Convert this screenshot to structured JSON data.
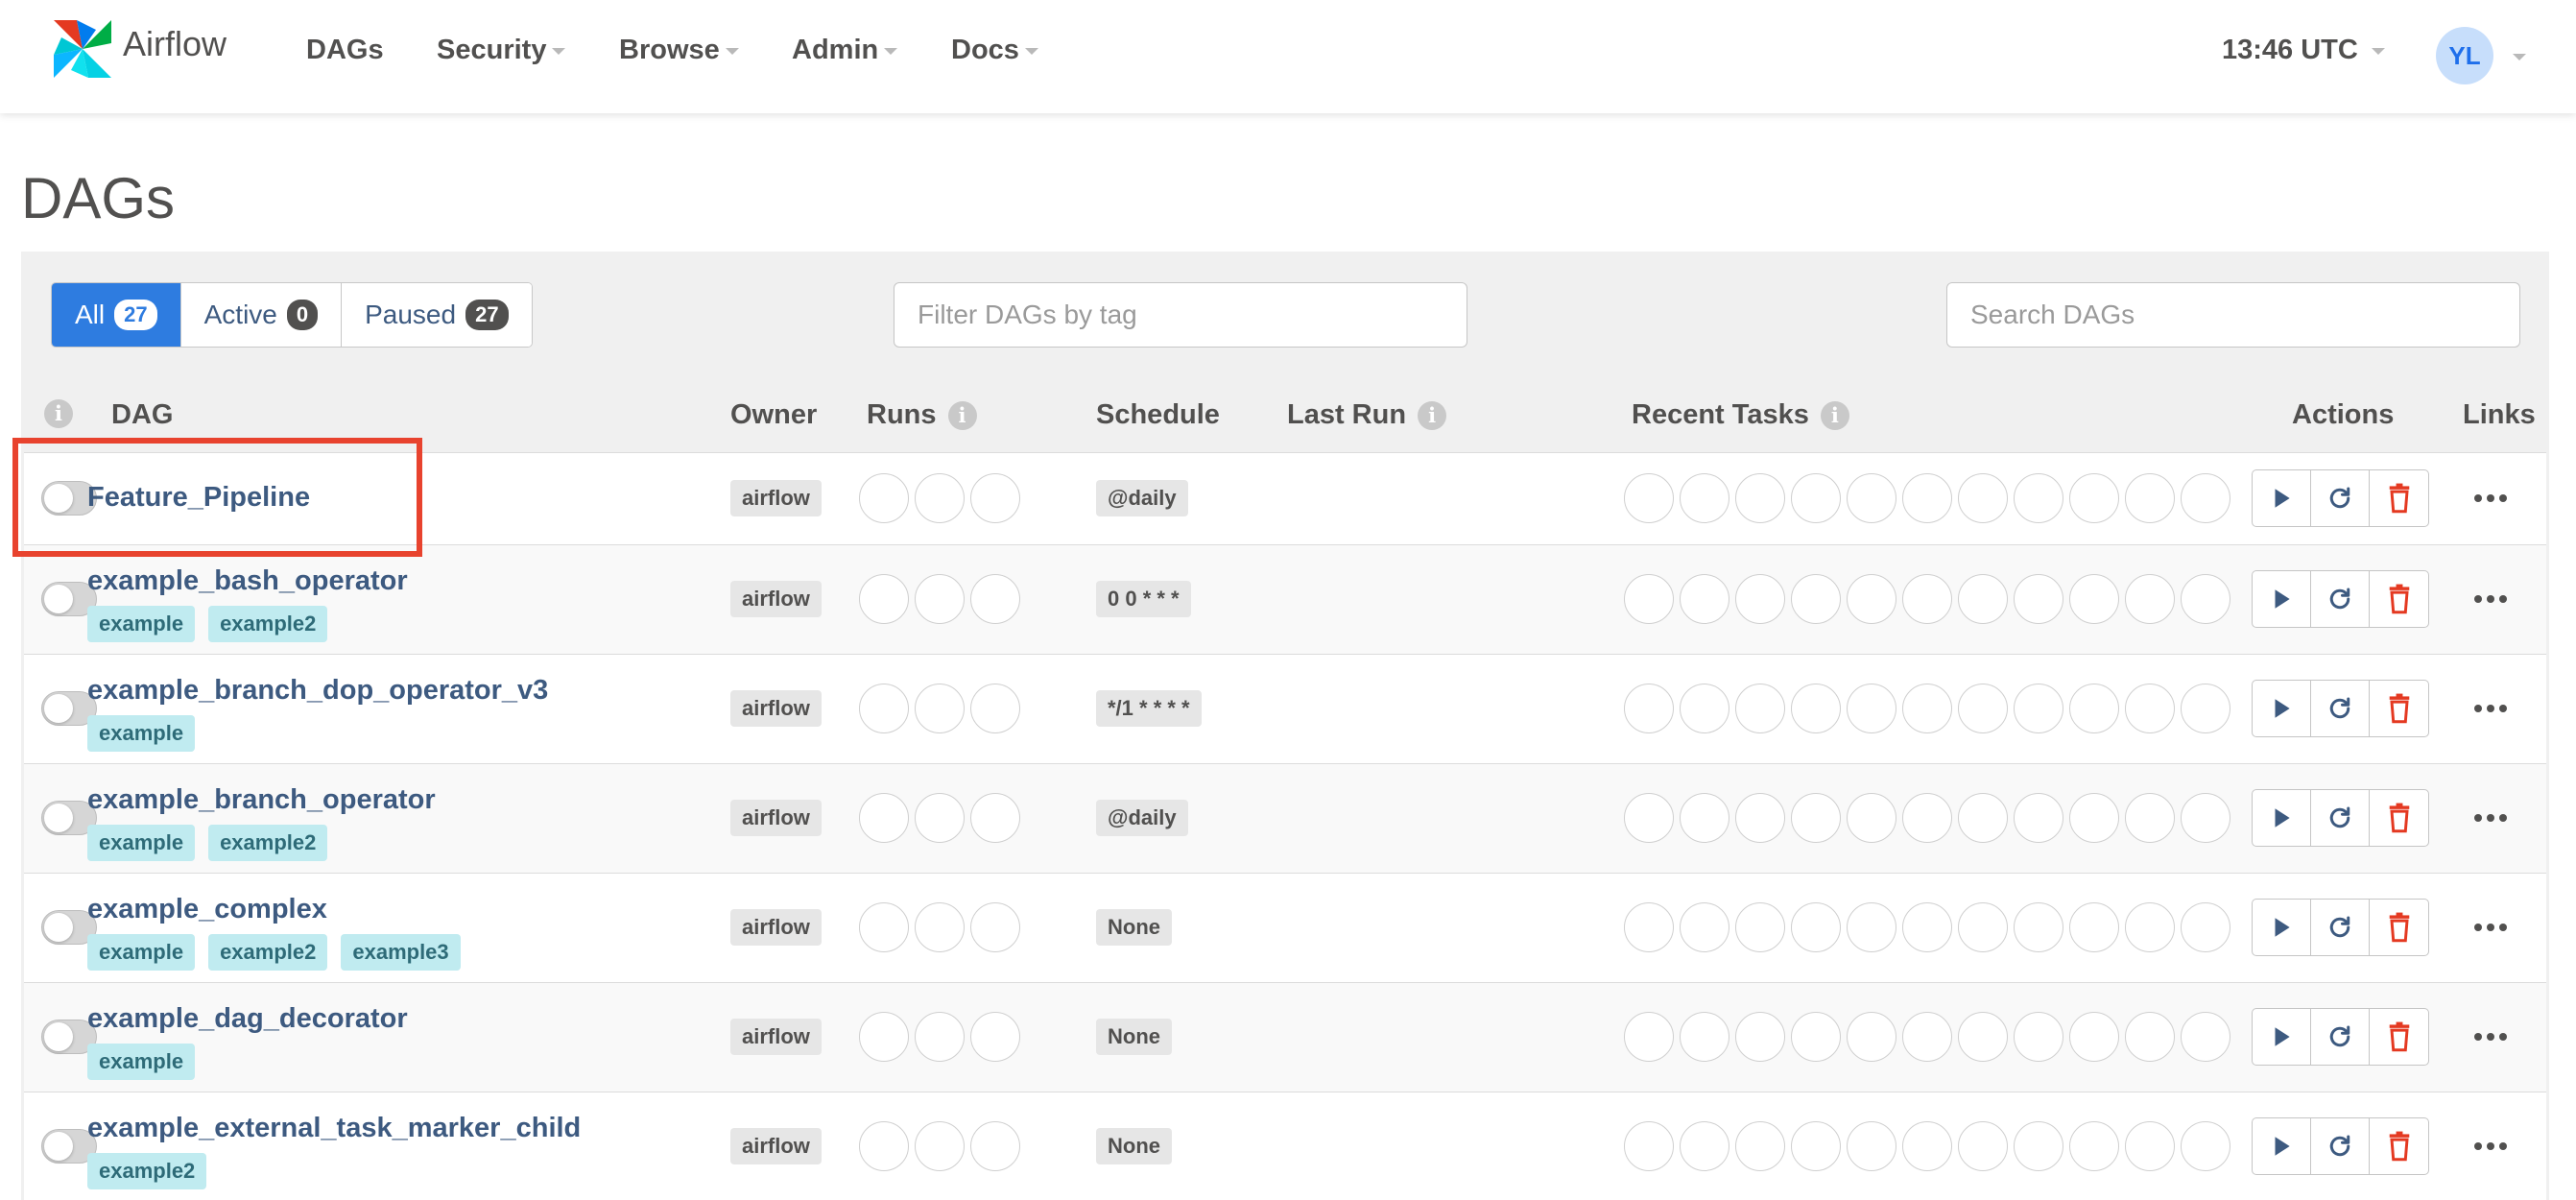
{
  "nav": {
    "brand": "Airflow",
    "items": [
      "DAGs",
      "Security",
      "Browse",
      "Admin",
      "Docs"
    ],
    "time": "13:46 UTC",
    "user_initials": "YL"
  },
  "page_title": "DAGs",
  "filters": {
    "status": [
      {
        "label": "All",
        "count": "27",
        "active": true
      },
      {
        "label": "Active",
        "count": "0",
        "active": false
      },
      {
        "label": "Paused",
        "count": "27",
        "active": false
      }
    ],
    "tag_placeholder": "Filter DAGs by tag",
    "search_placeholder": "Search DAGs"
  },
  "columns": {
    "info": "i",
    "dag": "DAG",
    "owner": "Owner",
    "runs": "Runs",
    "schedule": "Schedule",
    "last_run": "Last Run",
    "recent_tasks": "Recent Tasks",
    "actions": "Actions",
    "links": "Links"
  },
  "dags": [
    {
      "name": "Feature_Pipeline",
      "tags": [],
      "owner": "airflow",
      "schedule": "@daily"
    },
    {
      "name": "example_bash_operator",
      "tags": [
        "example",
        "example2"
      ],
      "owner": "airflow",
      "schedule": "0 0 * * *"
    },
    {
      "name": "example_branch_dop_operator_v3",
      "tags": [
        "example"
      ],
      "owner": "airflow",
      "schedule": "*/1 * * * *"
    },
    {
      "name": "example_branch_operator",
      "tags": [
        "example",
        "example2"
      ],
      "owner": "airflow",
      "schedule": "@daily"
    },
    {
      "name": "example_complex",
      "tags": [
        "example",
        "example2",
        "example3"
      ],
      "owner": "airflow",
      "schedule": "None"
    },
    {
      "name": "example_dag_decorator",
      "tags": [
        "example"
      ],
      "owner": "airflow",
      "schedule": "None"
    },
    {
      "name": "example_external_task_marker_child",
      "tags": [
        "example2"
      ],
      "owner": "airflow",
      "schedule": "None"
    }
  ],
  "colors": {
    "accent": "#2e7ce0",
    "link": "#3d5a80",
    "tag_bg": "#c0ebf0",
    "delete": "#e43921",
    "highlight": "#e8432e"
  }
}
